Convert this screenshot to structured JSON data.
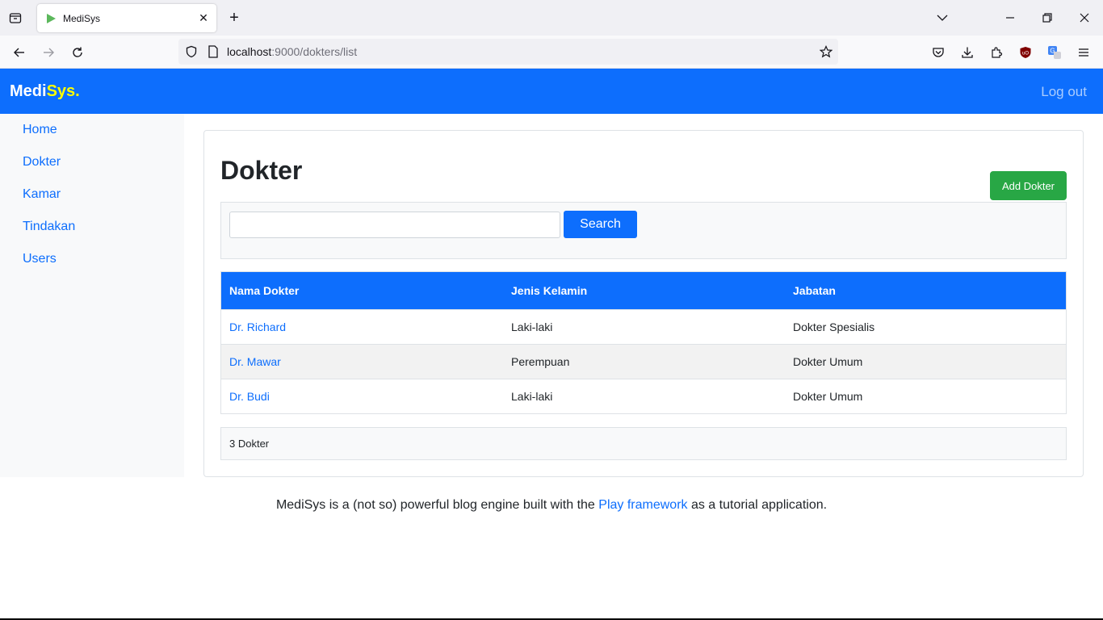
{
  "browser": {
    "tab_title": "MediSys",
    "url_host": "localhost",
    "url_rest": ":9000/dokters/list",
    "icons": [
      "tab-list-icon",
      "close-icon",
      "plus-icon",
      "chevron-down-icon",
      "minimize-icon",
      "restore-icon",
      "close-window-icon",
      "back-icon",
      "forward-icon",
      "reload-icon",
      "shield-icon",
      "page-icon",
      "star-icon",
      "pocket-icon",
      "download-icon",
      "extensions-icon",
      "ublock-icon",
      "translate-icon",
      "menu-icon"
    ]
  },
  "header": {
    "brand_part1": "Medi",
    "brand_part2": "Sys.",
    "logout": "Log out",
    "bg_color": "#0d6efd"
  },
  "sidebar": {
    "items": [
      {
        "label": "Home"
      },
      {
        "label": "Dokter"
      },
      {
        "label": "Kamar"
      },
      {
        "label": "Tindakan"
      },
      {
        "label": "Users"
      }
    ]
  },
  "main": {
    "title": "Dokter",
    "add_button": "Add Dokter",
    "search": {
      "value": "",
      "placeholder": "",
      "button": "Search"
    },
    "table": {
      "headers": [
        "Nama Dokter",
        "Jenis Kelamin",
        "Jabatan"
      ],
      "rows": [
        [
          "Dr. Richard",
          "Laki-laki",
          "Dokter Spesialis"
        ],
        [
          "Dr. Mawar",
          "Perempuan",
          "Dokter Umum"
        ],
        [
          "Dr. Budi",
          "Laki-laki",
          "Dokter Umum"
        ]
      ]
    },
    "count": "3 Dokter"
  },
  "footer": {
    "text_before": "MediSys is a (not so) powerful blog engine built with the ",
    "link": "Play framework",
    "text_after": " as a tutorial application."
  }
}
